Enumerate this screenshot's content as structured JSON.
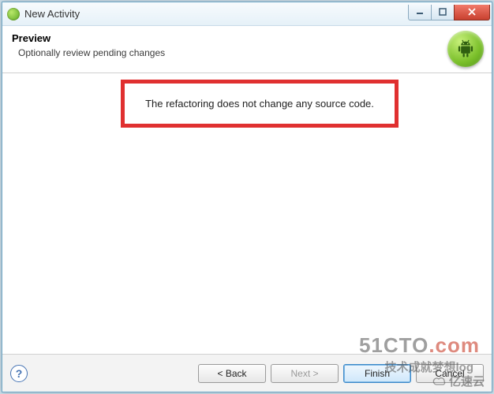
{
  "window": {
    "title": "New Activity"
  },
  "header": {
    "title": "Preview",
    "subtitle": "Optionally review pending changes"
  },
  "content": {
    "message": "The refactoring does not change any source code."
  },
  "footer": {
    "back_label": "< Back",
    "next_label": "Next >",
    "finish_label": "Finish",
    "cancel_label": "Cancel",
    "help_symbol": "?"
  },
  "watermarks": {
    "w1_prefix": "51CTO",
    "w1_suffix": ".com",
    "w2": "技术成就梦想log",
    "w3": "亿速云"
  }
}
